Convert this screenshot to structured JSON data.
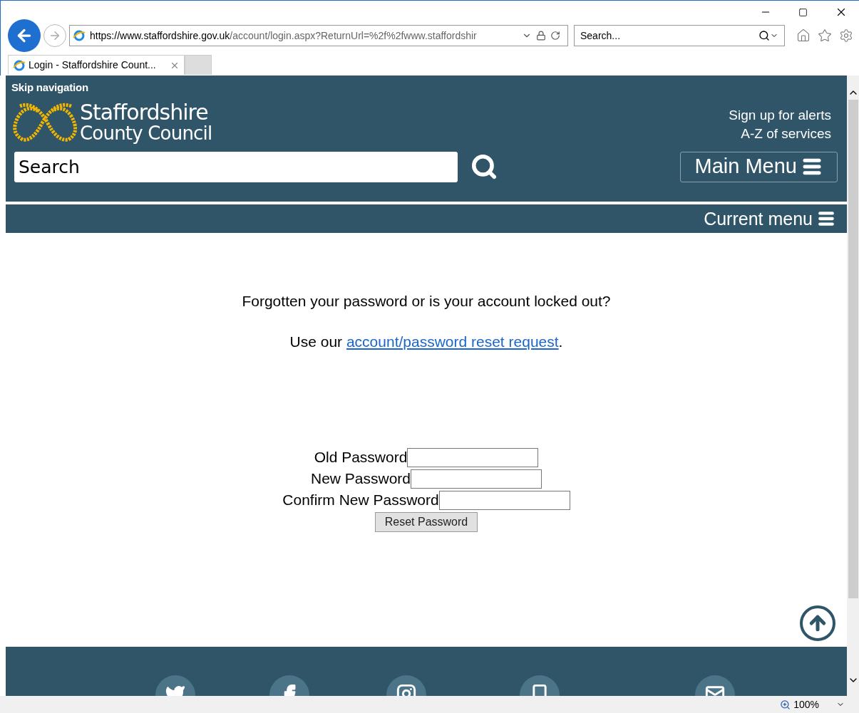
{
  "browser": {
    "address_host": "https://www.staffordshire.gov.uk",
    "address_path": "/account/login.aspx?ReturnUrl=%2f%2fwww.staffordshir",
    "search_placeholder": "Search...",
    "tabs": [
      {
        "label": "Login - Staffordshire Count...",
        "selected": true
      }
    ],
    "zoom": "100%"
  },
  "header": {
    "skip_link": "Skip navigation",
    "logo_line_1": "Staffordshire",
    "logo_line_2": "County Council",
    "links": [
      "Sign up for alerts",
      "A-Z of services"
    ],
    "search_placeholder": "Search",
    "main_menu": "Main Menu",
    "current_menu": "Current menu"
  },
  "content": {
    "question": "Forgotten your password or is your account locked out?",
    "reset_prefix": "Use our ",
    "reset_link": "account/password reset request",
    "reset_suffix": ".",
    "fields": [
      {
        "label": "Old Password"
      },
      {
        "label": "New Password"
      },
      {
        "label": "Confirm New Password"
      }
    ],
    "button": "Reset Password"
  },
  "footer": {
    "icons": [
      {
        "kind": "twitter"
      },
      {
        "kind": "facebook"
      },
      {
        "kind": "instagram"
      },
      {
        "kind": "phone"
      },
      {
        "kind": "mail"
      }
    ]
  }
}
